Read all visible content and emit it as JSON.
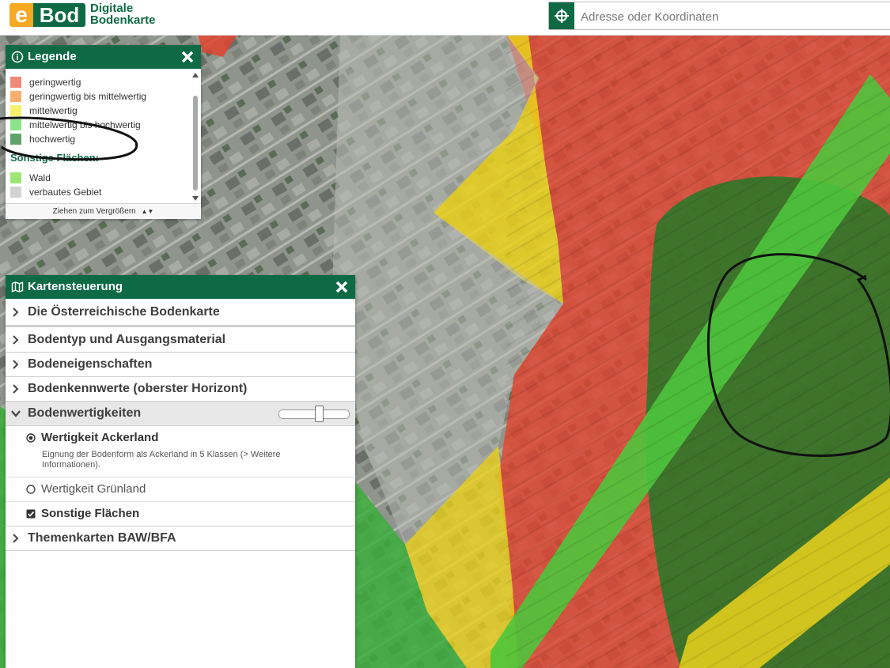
{
  "header": {
    "logo_e": "e",
    "logo_bod": "Bod",
    "brand_line1": "Digitale",
    "brand_line2": "Bodenkarte",
    "search_placeholder": "Adresse oder Koordinaten",
    "search_icon": "crosshair-locate-icon"
  },
  "legend": {
    "title": "Legende",
    "items": [
      {
        "label": "geringwertig",
        "color": "#f08a7a"
      },
      {
        "label": "geringwertig bis mittelwertig",
        "color": "#f5b070"
      },
      {
        "label": "mittelwertig",
        "color": "#f6f16c"
      },
      {
        "label": "mittelwertig bis hochwertig",
        "color": "#8ce58b"
      },
      {
        "label": "hochwertig",
        "color": "#5fa36a"
      }
    ],
    "section_title": "Sonstige Flächen:",
    "section_items": [
      {
        "label": "Wald",
        "color": "#9ee674"
      },
      {
        "label": "verbautes Gebiet",
        "color": "#d3d3d3"
      }
    ],
    "footer": "Ziehen zum Vergrößern"
  },
  "kartensteuerung": {
    "title": "Kartensteuerung",
    "rows": [
      {
        "label": "Die Österreichische Bodenkarte"
      },
      {
        "label": "Bodentyp und Ausgangsmaterial"
      },
      {
        "label": "Bodeneigenschaften"
      },
      {
        "label": "Bodenkennwerte (oberster Horizont)"
      },
      {
        "label": "Bodenwertigkeiten"
      },
      {
        "label": "Themenkarten BAW/BFA"
      }
    ],
    "opacity_slider": 0.58,
    "options": {
      "ackerland_label": "Wertigkeit Ackerland",
      "ackerland_desc": "Eignung der Bodenform als Ackerland in 5 Klassen (> Weitere Informationen).",
      "gruenland_label": "Wertigkeit Grünland",
      "sonstige_label": "Sonstige Flächen"
    }
  },
  "map": {
    "colors": {
      "geringwertig": "#e0442f",
      "mittelwertig": "#ecd21c",
      "hochwertig": "#1d7a27",
      "mittel_hoch": "#4ec53c",
      "verbaut": "#a3a6a1",
      "wald": "#3cad3c"
    }
  },
  "colors": {
    "brand_green": "#0e6a45",
    "brand_orange": "#f7a823"
  }
}
